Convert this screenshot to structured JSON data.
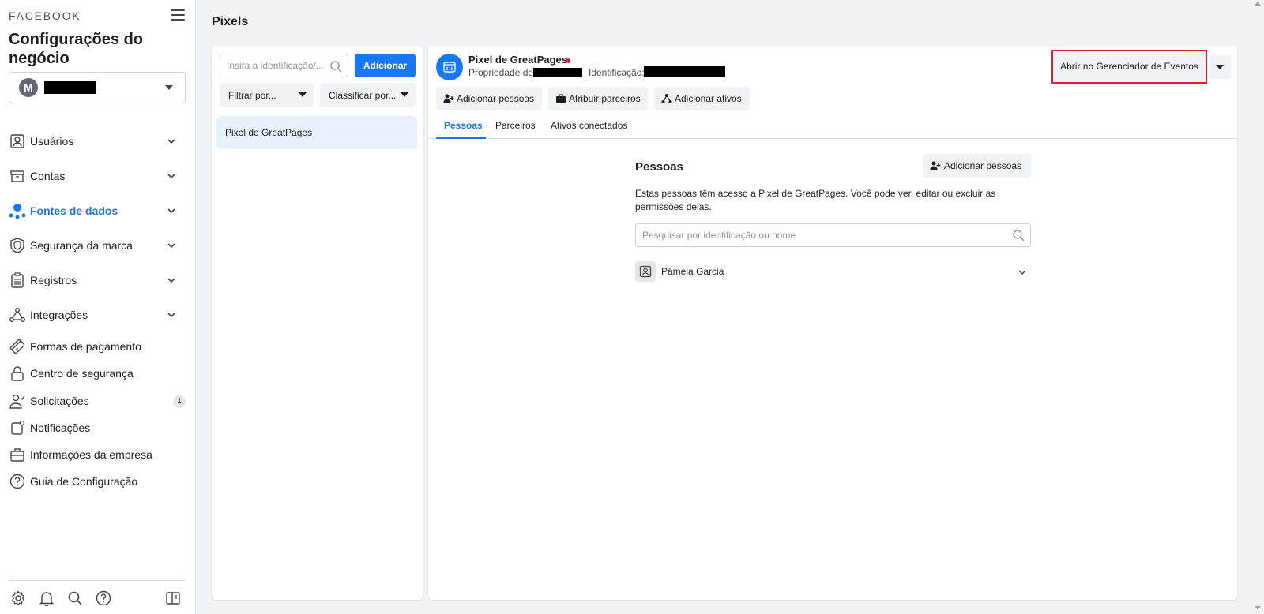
{
  "sidebar": {
    "brand": "FACEBOOK",
    "title": "Configurações do negócio",
    "account": {
      "avatar_letter": "M"
    },
    "items": [
      {
        "label": "Usuários",
        "icon": "users-icon",
        "expandable": true
      },
      {
        "label": "Contas",
        "icon": "accounts-icon",
        "expandable": true
      },
      {
        "label": "Fontes de dados",
        "icon": "data-sources-icon",
        "expandable": true,
        "active": true
      },
      {
        "label": "Segurança da marca",
        "icon": "shield-icon",
        "expandable": true
      },
      {
        "label": "Registros",
        "icon": "clipboard-icon",
        "expandable": true
      },
      {
        "label": "Integrações",
        "icon": "integrations-icon",
        "expandable": true
      },
      {
        "label": "Formas de pagamento",
        "icon": "credit-card-icon"
      },
      {
        "label": "Centro de segurança",
        "icon": "lock-icon"
      },
      {
        "label": "Solicitações",
        "icon": "person-check-icon",
        "badge": "1"
      },
      {
        "label": "Notificações",
        "icon": "notification-icon"
      },
      {
        "label": "Informações da empresa",
        "icon": "briefcase-icon"
      },
      {
        "label": "Guia de Configuração",
        "icon": "help-icon"
      }
    ],
    "footer_icons": [
      "gear-icon",
      "bell-icon",
      "search-icon",
      "help-icon",
      "panel-toggle-icon"
    ]
  },
  "page": {
    "title": "Pixels"
  },
  "list": {
    "search_placeholder": "Insira a identificação/...",
    "add_label": "Adicionar",
    "filter_label": "Filtrar por...",
    "sort_label": "Classificar por...",
    "items": [
      "Pixel de GreatPages"
    ]
  },
  "detail": {
    "name": "Pixel de GreatPages",
    "status_color": "#e41e3f",
    "owner_label": "Propriedade de:",
    "id_label": "Identificação:",
    "open_events_label": "Abrir no Gerenciador de Eventos",
    "actions": {
      "add_people": "Adicionar pessoas",
      "assign_partners": "Atribuir parceiros",
      "add_assets": "Adicionar ativos"
    },
    "tabs": [
      "Pessoas",
      "Parceiros",
      "Ativos conectados"
    ],
    "people": {
      "heading": "Pessoas",
      "add_label": "Adicionar pessoas",
      "description": "Estas pessoas têm acesso a Pixel de GreatPages. Você pode ver, editar ou excluir as permissões delas.",
      "search_placeholder": "Pesquisar por identificação ou nome",
      "rows": [
        "Pâmela Garcia"
      ]
    }
  },
  "colors": {
    "accent": "#1877f2",
    "highlight": "#e02020"
  }
}
